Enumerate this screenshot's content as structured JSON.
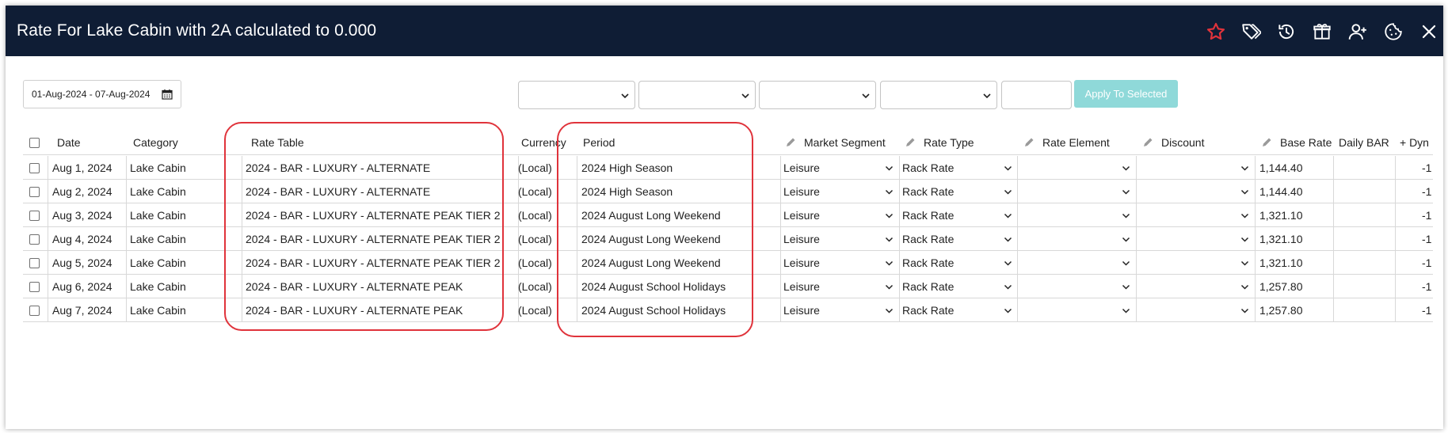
{
  "window": {
    "title": "Rate For Lake Cabin with 2A calculated to 0.000",
    "accent_color": "#e0333b",
    "titlebar_color": "#0f1d35",
    "icons": [
      "star-icon",
      "tags-icon",
      "history-icon",
      "gift-box-icon",
      "add-user-icon",
      "cookie-icon",
      "close-icon"
    ]
  },
  "toolbar": {
    "date_range": "01-Aug-2024 - 07-Aug-2024",
    "apply_button": "Apply To Selected",
    "apply_button_color": "#8fd9d9"
  },
  "table": {
    "headers": {
      "date": "Date",
      "category": "Category",
      "rate_table": "Rate Table",
      "currency": "Currency",
      "period": "Period",
      "market_segment": "Market Segment",
      "rate_type": "Rate Type",
      "rate_element": "Rate Element",
      "discount": "Discount",
      "base_rate": "Base Rate",
      "daily_bar": "Daily BAR",
      "dynamic": "+ Dyn"
    },
    "rows": [
      {
        "date": "Aug 1, 2024",
        "category": "Lake Cabin",
        "rate_table": "2024 - BAR - LUXURY - ALTERNATE",
        "currency": "(Local)",
        "period": "2024 High Season",
        "market_segment": "Leisure",
        "rate_type": "Rack Rate",
        "rate_element": "",
        "discount": "",
        "base_rate": "1,144.40",
        "daily_bar": "",
        "dynamic": "-1"
      },
      {
        "date": "Aug 2, 2024",
        "category": "Lake Cabin",
        "rate_table": "2024 - BAR - LUXURY - ALTERNATE",
        "currency": "(Local)",
        "period": "2024 High Season",
        "market_segment": "Leisure",
        "rate_type": "Rack Rate",
        "rate_element": "",
        "discount": "",
        "base_rate": "1,144.40",
        "daily_bar": "",
        "dynamic": "-1"
      },
      {
        "date": "Aug 3, 2024",
        "category": "Lake Cabin",
        "rate_table": "2024 - BAR - LUXURY - ALTERNATE PEAK TIER 2",
        "currency": "(Local)",
        "period": "2024 August Long Weekend",
        "market_segment": "Leisure",
        "rate_type": "Rack Rate",
        "rate_element": "",
        "discount": "",
        "base_rate": "1,321.10",
        "daily_bar": "",
        "dynamic": "-1"
      },
      {
        "date": "Aug 4, 2024",
        "category": "Lake Cabin",
        "rate_table": "2024 - BAR - LUXURY - ALTERNATE PEAK TIER 2",
        "currency": "(Local)",
        "period": "2024 August Long Weekend",
        "market_segment": "Leisure",
        "rate_type": "Rack Rate",
        "rate_element": "",
        "discount": "",
        "base_rate": "1,321.10",
        "daily_bar": "",
        "dynamic": "-1"
      },
      {
        "date": "Aug 5, 2024",
        "category": "Lake Cabin",
        "rate_table": "2024 - BAR - LUXURY - ALTERNATE PEAK TIER 2",
        "currency": "(Local)",
        "period": "2024 August Long Weekend",
        "market_segment": "Leisure",
        "rate_type": "Rack Rate",
        "rate_element": "",
        "discount": "",
        "base_rate": "1,321.10",
        "daily_bar": "",
        "dynamic": "-1"
      },
      {
        "date": "Aug 6, 2024",
        "category": "Lake Cabin",
        "rate_table": "2024 - BAR - LUXURY - ALTERNATE PEAK",
        "currency": "(Local)",
        "period": "2024 August School Holidays",
        "market_segment": "Leisure",
        "rate_type": "Rack Rate",
        "rate_element": "",
        "discount": "",
        "base_rate": "1,257.80",
        "daily_bar": "",
        "dynamic": "-1"
      },
      {
        "date": "Aug 7, 2024",
        "category": "Lake Cabin",
        "rate_table": "2024 - BAR - LUXURY - ALTERNATE PEAK",
        "currency": "(Local)",
        "period": "2024 August School Holidays",
        "market_segment": "Leisure",
        "rate_type": "Rack Rate",
        "rate_element": "",
        "discount": "",
        "base_rate": "1,257.80",
        "daily_bar": "",
        "dynamic": "-1"
      }
    ]
  }
}
